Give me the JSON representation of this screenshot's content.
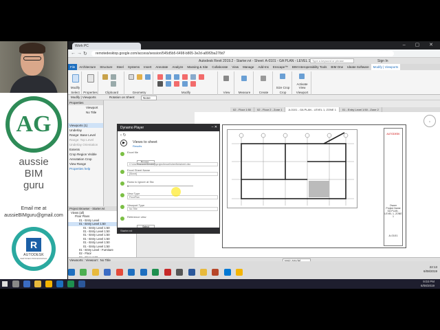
{
  "presenter": {
    "brand_letters": "AG",
    "brand_line1": "aussie",
    "brand_line2": "BIM",
    "brand_line3": "guru",
    "email_label": "Email me at",
    "email": "aussieBIMguru@gmail.com",
    "badge_line1": "AUTODESK",
    "badge_line2": "CERTIFIED PROFESSIONAL"
  },
  "browser": {
    "tab_title": "Work PC",
    "url": "remotedesktop.google.com/access/session/545d5b5-6498-b805-3e2d-a89f2ba278d7"
  },
  "revit": {
    "app_title": "Autodesk Revit 2019.2 - Starter.rvt - Sheet: A-0101 - GA PLAN - LEVEL 1, ZONE 1",
    "search_placeholder": "Type a keyword or phrase",
    "sign_in": "Sign In",
    "menu_tabs": [
      "File",
      "Architecture",
      "Structure",
      "Steel",
      "Systems",
      "Insert",
      "Annotate",
      "Analyze",
      "Massing & Site",
      "Collaborate",
      "View",
      "Manage",
      "Add-Ins",
      "Enscape™",
      "BIM Interoperability Tools",
      "BIM One",
      "Ideate Software",
      "Modify | Viewports"
    ],
    "ribbon_groups": [
      "Select",
      "Properties",
      "Clipboard",
      "Geometry",
      "Modify",
      "View",
      "Measure",
      "Create",
      "Crop",
      "Viewport"
    ],
    "ribbon_btn_modify": "Modify",
    "ribbon_btn_size_crop": "Size Crop",
    "ribbon_btn_activate_view": "Activate View",
    "context_bar": "Modify | Viewports",
    "rotation_label": "Rotation on Sheet:",
    "rotation_value": "None",
    "status": "Viewports : Viewport : No Title",
    "status_right": "Main Model"
  },
  "properties": {
    "header": "Properties",
    "type_line1": "Viewport",
    "type_line2": "No Title",
    "selector": "Viewports (1)",
    "section": "Underlay",
    "rows": [
      "Range: Base Level",
      "Range: Top Level",
      "Underlay Orientation",
      "Extents",
      "Crop Region Visible",
      "Annotation Crop",
      "View Range"
    ],
    "help_link": "Properties help"
  },
  "dynamo": {
    "title": "Dynamo Player",
    "script_name": "Views to sheet",
    "script_sub": "Results",
    "nodes": [
      {
        "label": "Excel file",
        "value": "Browse...",
        "kind": "button"
      },
      {
        "label": "",
        "value": "C:\\Users\\aussie\\Desktop\\project\\excel\\sheet\\to\\sheet.xlsx",
        "kind": "box"
      },
      {
        "label": "Excel Sheet Name",
        "value": "[Sheet]",
        "kind": "box"
      },
      {
        "label": "Rows to Ignore at Sta",
        "value": "1",
        "kind": "slider"
      },
      {
        "label": "View Type",
        "value": "FloorPlan",
        "kind": "box"
      },
      {
        "label": "Viewport Type",
        "value": "No Title",
        "kind": "box"
      },
      {
        "label": "Reference view",
        "value": "Select",
        "kind": "button"
      },
      {
        "label": "",
        "value": "Element : 501/27",
        "kind": "text"
      }
    ],
    "footer": "Starter.rvt"
  },
  "project_browser": {
    "header": "Project Browser - Starter.rvt",
    "items": [
      "Views (all)",
      "Floor Plans",
      "01 - Entry Level",
      "01 - Entry Level 1:50",
      "01 - Entry Level 1:50",
      "01 - Entry Level 1:50",
      "01 - Entry Level 1:50",
      "01 - Entry Level 1:50",
      "01 - Entry Level 1:50",
      "01 - Entry Level 1:50",
      "01 - Entry Level - Furniture",
      "02 - Floor",
      "02 - Floor 1:50",
      "03 - Floor",
      "04 - Floor",
      "Roof",
      "Site"
    ],
    "selected_index": 3
  },
  "view_tabs": [
    "02 - Floor 1:50",
    "02 - Floor 2 - Zone 1",
    "A-0101 - GA PLAN - LEVEL 1, ZONE 1",
    "01 - Entry Level 1:50 - Zone 2"
  ],
  "active_view_tab": 2,
  "title_block": {
    "company": "AUTODESK",
    "owner": "Owner",
    "project": "Project Name",
    "sheet_title": "GA PLAN - LEVEL 1, ZONE 1",
    "sheet_number": "A-0101"
  },
  "clock": {
    "time": "9:03 PM",
    "date": "6/08/2019"
  },
  "browser_clock": {
    "time": "22:13",
    "date": "6/08/2019"
  },
  "colors": {
    "dynamo_bar": "#2d2d30",
    "accent": "#1e6fbf",
    "brand_green": "#2e8b57",
    "check_green": "#7bbf44"
  }
}
